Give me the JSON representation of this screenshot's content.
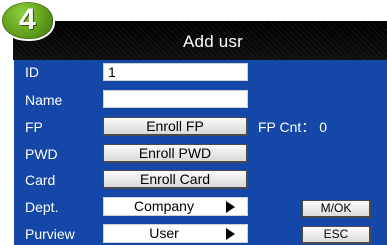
{
  "badge": {
    "number": "4"
  },
  "window": {
    "title": "Add usr"
  },
  "fields": {
    "id": {
      "label": "ID",
      "value": "1"
    },
    "name": {
      "label": "Name",
      "value": ""
    },
    "fp": {
      "label": "FP",
      "button": "Enroll FP",
      "count_text": "FP Cnt： 0"
    },
    "pwd": {
      "label": "PWD",
      "button": "Enroll PWD"
    },
    "card": {
      "label": "Card",
      "button": "Enroll Card"
    },
    "dept": {
      "label": "Dept.",
      "selected": "Company"
    },
    "purview": {
      "label": "Purview",
      "selected": "User"
    }
  },
  "actions": {
    "ok": "M/OK",
    "esc": "ESC"
  },
  "colors": {
    "panel": "#1447a8",
    "titlebar": "#000000",
    "badge": "#69a820"
  }
}
